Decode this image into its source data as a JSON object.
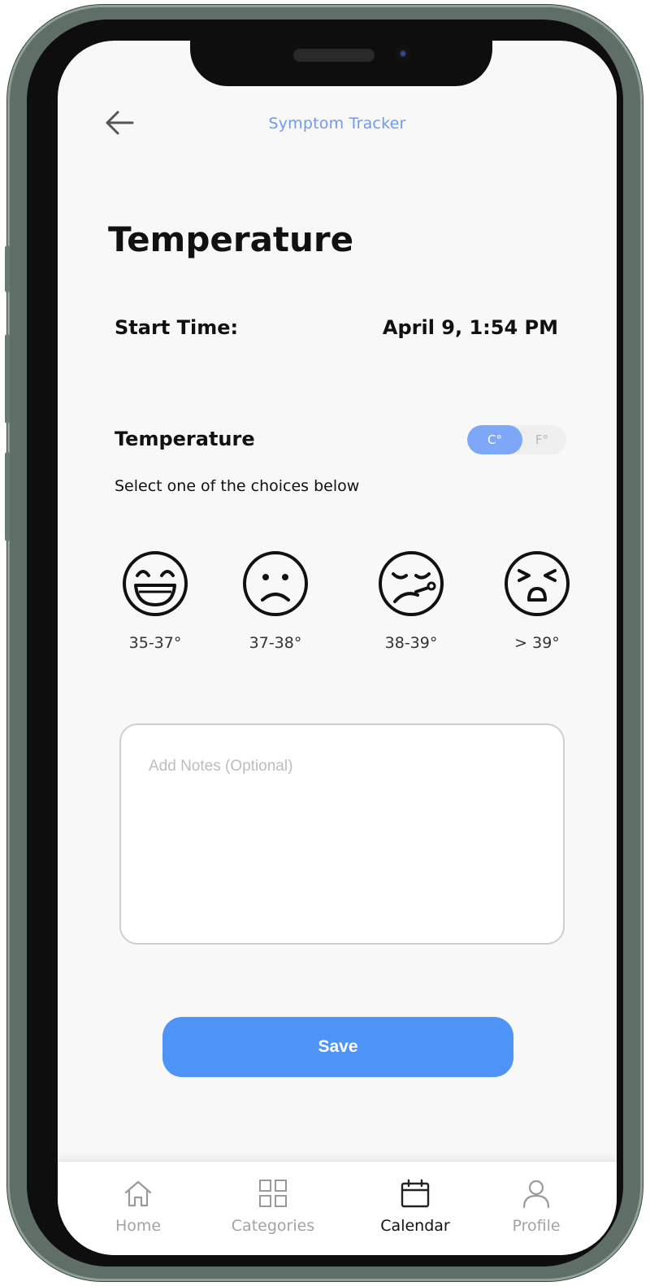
{
  "header": {
    "back_icon": "arrow-left-icon",
    "title": "Symptom Tracker"
  },
  "page": {
    "title": "Temperature"
  },
  "start_time": {
    "label": "Start Time:",
    "value": "April 9, 1:54 PM"
  },
  "temperature": {
    "label": "Temperature",
    "unit_toggle": {
      "options": [
        "C°",
        "F°"
      ],
      "selected": "C°"
    },
    "instruction": "Select one of the choices below",
    "choices": [
      {
        "label": "35-37°",
        "icon": "laughing-face-icon"
      },
      {
        "label": "37-38°",
        "icon": "sad-face-icon"
      },
      {
        "label": "38-39°",
        "icon": "sick-face-icon"
      },
      {
        "label": "> 39°",
        "icon": "distressed-face-icon"
      }
    ]
  },
  "notes": {
    "placeholder": "Add Notes (Optional)",
    "value": ""
  },
  "save_button": {
    "label": "Save"
  },
  "tabbar": {
    "items": [
      {
        "label": "Home",
        "icon": "home-icon",
        "active": false
      },
      {
        "label": "Categories",
        "icon": "grid-icon",
        "active": false
      },
      {
        "label": "Calendar",
        "icon": "calendar-icon",
        "active": true
      },
      {
        "label": "Profile",
        "icon": "user-icon",
        "active": false
      }
    ]
  },
  "colors": {
    "accent": "#4e93f6",
    "header_text": "#6f9af0",
    "toggle_active": "#7ea8f7",
    "frame": "#5f6e66"
  }
}
